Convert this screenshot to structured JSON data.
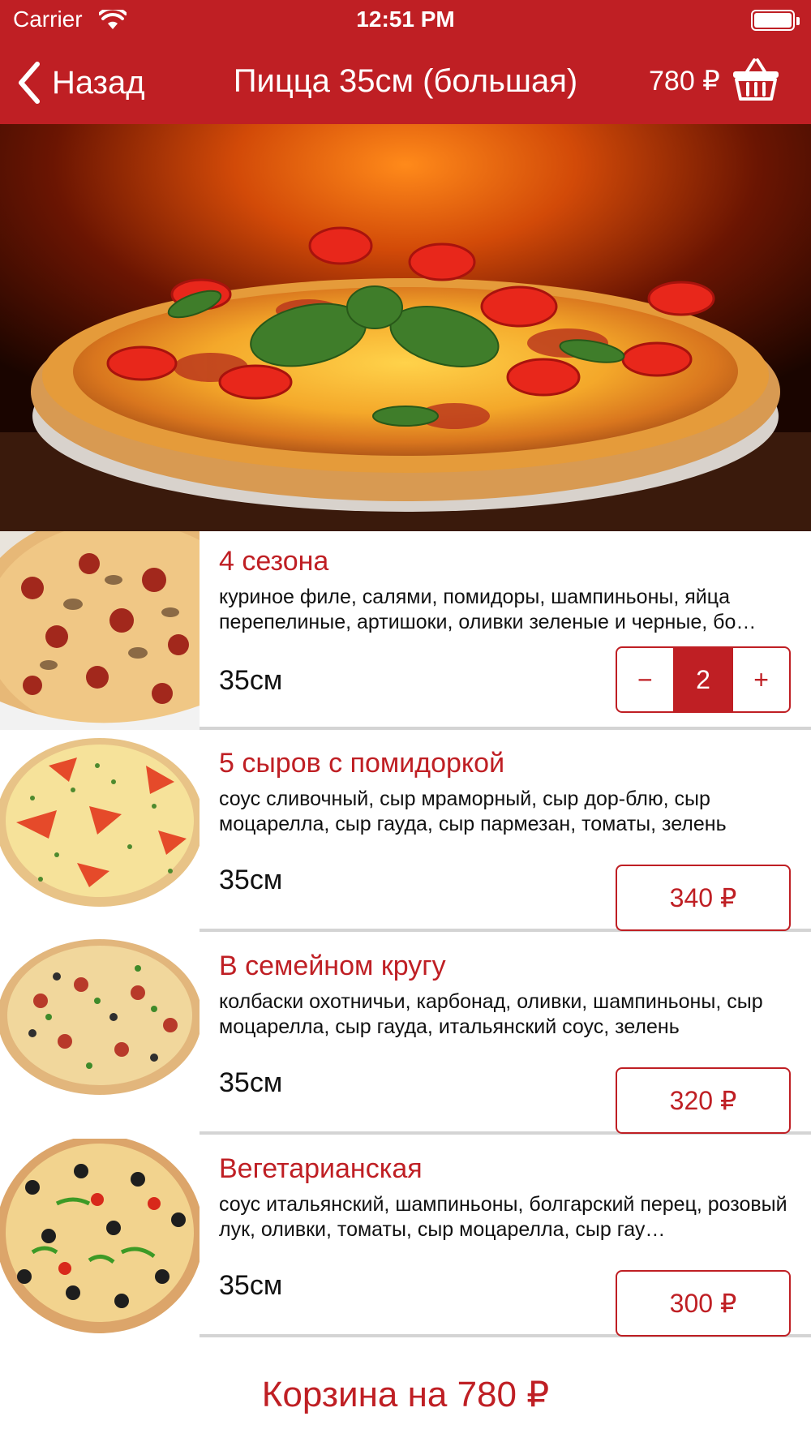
{
  "status_bar": {
    "carrier": "Carrier",
    "time": "12:51 PM"
  },
  "nav": {
    "back_label": "Назад",
    "title": "Пицца 35см (большая)",
    "cart_total": "780 ₽",
    "cart_icon": "basket-icon"
  },
  "colors": {
    "accent": "#bf1f24",
    "divider": "#d4d4d4",
    "background": "#ffffff"
  },
  "products": [
    {
      "name": "4 сезона",
      "description": "куриное филе, салями, помидоры, шампиньоны, яйца перепелиные, артишоки, оливки зеленые и черные, бо…",
      "size": "35см",
      "quantity": "2",
      "minus_label": "−",
      "plus_label": "+"
    },
    {
      "name": "5 сыров с помидоркой",
      "description": "соус сливочный, сыр мраморный, сыр дор-блю, сыр моцарелла, сыр гауда, сыр пармезан, томаты, зелень",
      "size": "35см",
      "price": "340 ₽"
    },
    {
      "name": "В семейном кругу",
      "description": "колбаски охотничьи, карбонад, оливки, шампиньоны, сыр моцарелла, сыр гауда, итальянский соус, зелень",
      "size": "35см",
      "price": "320 ₽"
    },
    {
      "name": "Вегетарианская",
      "description": "соус итальянский, шампиньоны, болгарский перец, розовый лук, оливки, томаты, сыр моцарелла, сыр гау…",
      "size": "35см",
      "price": "300 ₽"
    }
  ],
  "bottom_cart": {
    "label": "Корзина на 780 ₽"
  }
}
